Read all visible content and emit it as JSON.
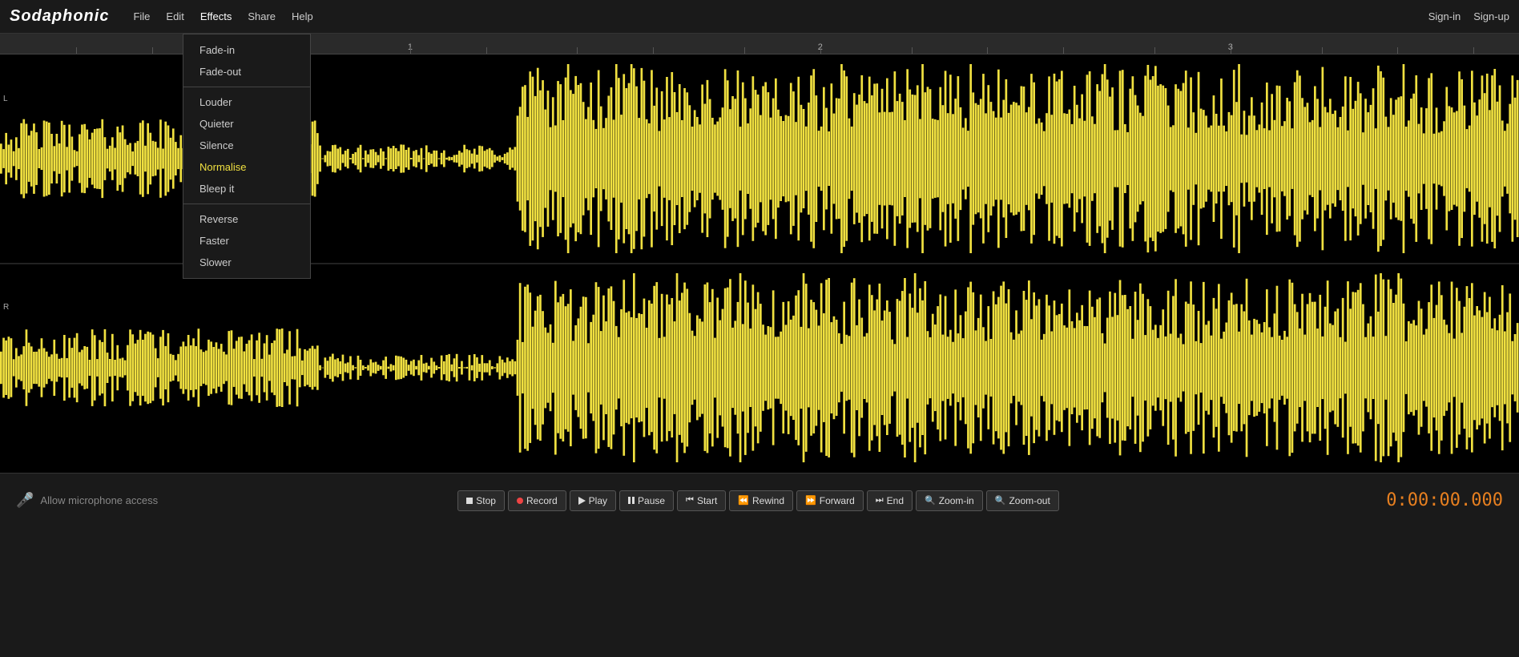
{
  "app": {
    "logo": "Sodaphonic",
    "nav": {
      "file": "File",
      "edit": "Edit",
      "effects": "Effects",
      "share": "Share",
      "help": "Help"
    },
    "header_right": {
      "signin": "Sign-in",
      "signup": "Sign-up"
    }
  },
  "effects_menu": {
    "items_group1": [
      {
        "id": "fade-in",
        "label": "Fade-in",
        "highlighted": false
      },
      {
        "id": "fade-out",
        "label": "Fade-out",
        "highlighted": false
      }
    ],
    "items_group2": [
      {
        "id": "louder",
        "label": "Louder",
        "highlighted": false
      },
      {
        "id": "quieter",
        "label": "Quieter",
        "highlighted": false
      },
      {
        "id": "silence",
        "label": "Silence",
        "highlighted": false
      },
      {
        "id": "normalise",
        "label": "Normalise",
        "highlighted": true
      },
      {
        "id": "bleep-it",
        "label": "Bleep it",
        "highlighted": false
      }
    ],
    "items_group3": [
      {
        "id": "reverse",
        "label": "Reverse",
        "highlighted": false
      },
      {
        "id": "faster",
        "label": "Faster",
        "highlighted": false
      },
      {
        "id": "slower",
        "label": "Slower",
        "highlighted": false
      }
    ]
  },
  "ruler": {
    "marks": [
      {
        "label": "1",
        "percent": 27
      },
      {
        "label": "2",
        "percent": 54
      },
      {
        "label": "3",
        "percent": 81
      }
    ]
  },
  "waveform": {
    "channel_left_label": "L",
    "channel_right_label": "R",
    "color": "#f0e040",
    "background": "#000"
  },
  "footer": {
    "mic_label": "Allow microphone access",
    "controls": [
      {
        "id": "stop",
        "label": "Stop",
        "icon": "stop-square"
      },
      {
        "id": "record",
        "label": "Record",
        "icon": "record-dot"
      },
      {
        "id": "play",
        "label": "Play",
        "icon": "play-tri"
      },
      {
        "id": "pause",
        "label": "Pause",
        "icon": "pause-bars"
      },
      {
        "id": "start",
        "label": "Start",
        "icon": "skip-start"
      },
      {
        "id": "rewind",
        "label": "Rewind",
        "icon": "rewind"
      },
      {
        "id": "forward",
        "label": "Forward",
        "icon": "forward"
      },
      {
        "id": "end",
        "label": "End",
        "icon": "skip-end"
      },
      {
        "id": "zoom-in",
        "label": "Zoom-in",
        "icon": "zoom-in"
      },
      {
        "id": "zoom-out",
        "label": "Zoom-out",
        "icon": "zoom-out"
      }
    ],
    "time_display": "0:00:00.000"
  }
}
